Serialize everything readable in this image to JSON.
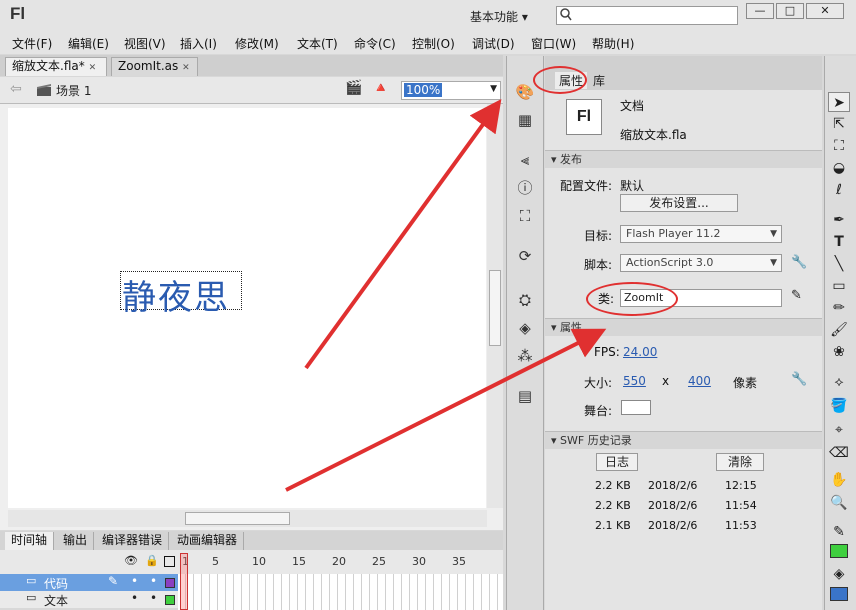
{
  "app": {
    "logo": "Fl",
    "workspace": "基本功能",
    "workspace_caret": "▾"
  },
  "window": {
    "minimize": "—",
    "maximize": "□",
    "close": "✕"
  },
  "menu": [
    "文件(F)",
    "编辑(E)",
    "视图(V)",
    "插入(I)",
    "修改(M)",
    "文本(T)",
    "命令(C)",
    "控制(O)",
    "调试(D)",
    "窗口(W)",
    "帮助(H)"
  ],
  "doc_tabs": [
    {
      "label": "缩放文本.fla*",
      "close": "✕"
    },
    {
      "label": "ZoomIt.as",
      "close": "✕"
    }
  ],
  "editbar": {
    "scene": "场景 1",
    "zoom": "100%"
  },
  "stage": {
    "text": "静夜思"
  },
  "timeline": {
    "tabs": [
      "时间轴",
      "输出",
      "编译器错误",
      "动画编辑器"
    ],
    "frame_numbers": [
      "1",
      "5",
      "10",
      "15",
      "20",
      "25",
      "30",
      "35"
    ],
    "layers": [
      {
        "name": "代码"
      },
      {
        "name": "文本"
      }
    ]
  },
  "properties": {
    "tabs": [
      "属性",
      "库"
    ],
    "doc_icon": "Fl",
    "doc_type": "文档",
    "doc_name": "缩放文本.fla",
    "publish_section": "发布",
    "profile_label": "配置文件:",
    "profile_value": "默认",
    "publish_settings_button": "发布设置...",
    "target_label": "目标:",
    "target_value": "Flash Player 11.2",
    "script_label": "脚本:",
    "script_value": "ActionScript 3.0",
    "class_label": "类:",
    "class_value": "ZoomIt",
    "props_section": "属性",
    "fps_label": "FPS:",
    "fps_value": "24.00",
    "size_label": "大小:",
    "width": "550",
    "x": "x",
    "height": "400",
    "unit": "像素",
    "stage_label": "舞台:",
    "swf_section": "SWF 历史记录",
    "log_button": "日志",
    "clear_button": "清除",
    "history": [
      {
        "size": "2.2 KB",
        "date": "2018/2/6",
        "time": "12:15"
      },
      {
        "size": "2.2 KB",
        "date": "2018/2/6",
        "time": "11:54"
      },
      {
        "size": "2.1 KB",
        "date": "2018/2/6",
        "time": "11:53"
      }
    ]
  },
  "colors": {
    "accent": "#3a74c8",
    "annotation": "#e03030",
    "stroke": "#000000",
    "fill": "#3fcf3f"
  }
}
